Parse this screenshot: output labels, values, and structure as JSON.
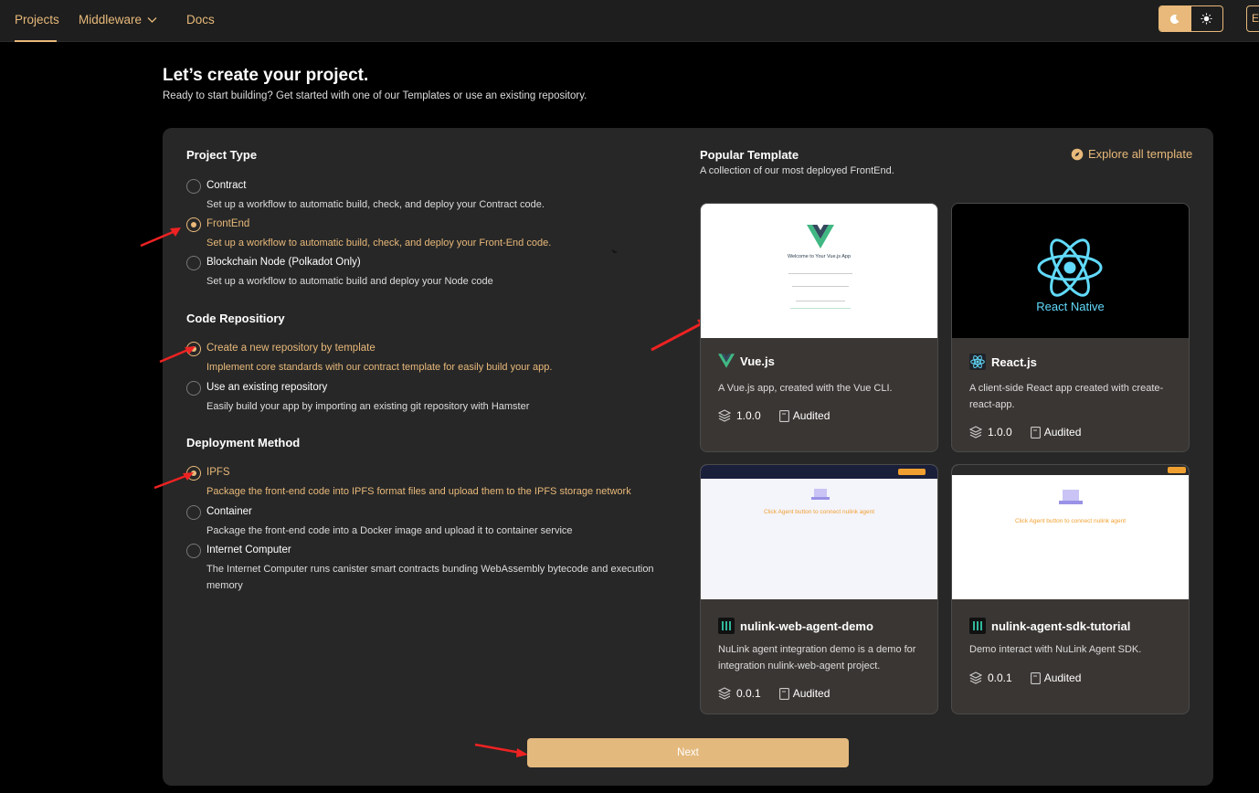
{
  "nav": {
    "projects": "Projects",
    "middleware": "Middleware",
    "docs": "Docs",
    "edge_button": "E"
  },
  "page": {
    "title": "Let’s create your project.",
    "subtitle": "Ready to start building? Get started with one of our Templates or use an existing repository."
  },
  "project_type": {
    "title": "Project Type",
    "options": [
      {
        "label": "Contract",
        "desc": "Set up a workflow to automatic build, check, and deploy your Contract code.",
        "selected": false
      },
      {
        "label": "FrontEnd",
        "desc": "Set up a workflow to automatic build, check, and deploy your Front-End code.",
        "selected": true
      },
      {
        "label": "Blockchain Node (Polkadot Only)",
        "desc": "Set up a workflow to automatic build and deploy your Node code",
        "selected": false
      }
    ]
  },
  "code_repo": {
    "title": "Code Repositiory",
    "options": [
      {
        "label": "Create a new repository by template",
        "desc": "Implement core standards with our contract template for easily build your app.",
        "selected": true
      },
      {
        "label": "Use an existing repository",
        "desc": "Easily build your app by importing an existing git repository with Hamster",
        "selected": false
      }
    ]
  },
  "deploy": {
    "title": "Deployment Method",
    "options": [
      {
        "label": "IPFS",
        "desc": "Package the front-end code into IPFS format files and upload them to the IPFS storage network",
        "selected": true
      },
      {
        "label": "Container",
        "desc": "Package the front-end code into a Docker image and upload it to container service",
        "selected": false
      },
      {
        "label": "Internet Computer",
        "desc": "The Internet Computer runs canister smart contracts bunding WebAssembly bytecode and execution memory",
        "selected": false
      }
    ]
  },
  "templates": {
    "title": "Popular Template",
    "subtitle": "A collection of our most deployed FrontEnd.",
    "explore": "Explore all template",
    "cards": [
      {
        "name": "Vue.js",
        "desc": "A Vue.js app, created with the Vue CLI.",
        "version": "1.0.0",
        "audited": "Audited",
        "thumb_text": "Welcome to Your Vue.js App"
      },
      {
        "name": "React.js",
        "desc": "A client-side React app created with create-react-app.",
        "version": "1.0.0",
        "audited": "Audited",
        "thumb_text": "React Native"
      },
      {
        "name": "nulink-web-agent-demo",
        "desc": "NuLink agent integration demo is a demo for integration nulink-web-agent project.",
        "version": "0.0.1",
        "audited": "Audited",
        "thumb_text": "Click Agent button to connect nulink agent"
      },
      {
        "name": "nulink-agent-sdk-tutorial",
        "desc": "Demo interact with NuLink Agent SDK.",
        "version": "0.0.1",
        "audited": "Audited",
        "thumb_text": "Click Agent button to connect nulink agent"
      }
    ]
  },
  "next_label": "Next",
  "colors": {
    "accent": "#e8b97a",
    "panel": "#272727",
    "card": "#3a3633"
  }
}
